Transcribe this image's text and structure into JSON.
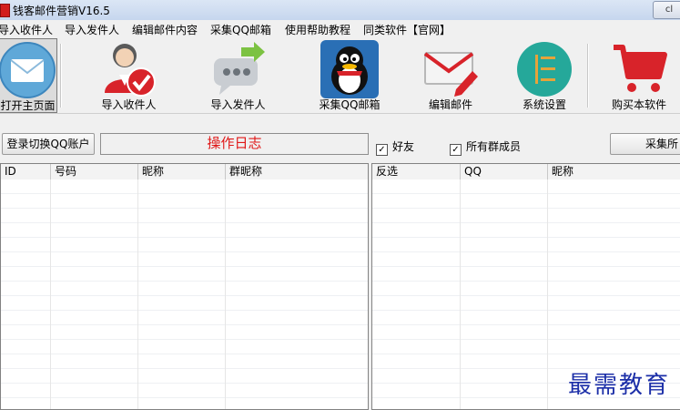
{
  "window": {
    "title": "钱客邮件营销V16.5",
    "control_label": "cl"
  },
  "menu": [
    "导入收件人",
    "导入发件人",
    "编辑邮件内容",
    "采集QQ邮箱",
    "使用帮助教程",
    "同类软件【官网】"
  ],
  "toolbar": [
    {
      "label": "打开主页面",
      "icon": "mail-envelope-icon"
    },
    {
      "label": "导入收件人",
      "icon": "user-check-icon"
    },
    {
      "label": "导入发件人",
      "icon": "chat-forward-icon"
    },
    {
      "label": "采集QQ邮箱",
      "icon": "qq-penguin-icon"
    },
    {
      "label": "编辑邮件",
      "icon": "edit-mail-icon"
    },
    {
      "label": "系统设置",
      "icon": "settings-list-icon"
    },
    {
      "label": "购买本软件",
      "icon": "shopping-cart-icon"
    }
  ],
  "controls": {
    "login_button": "登录切换QQ账户",
    "log_title": "操作日志",
    "friends_label": "好友",
    "friends_checked": true,
    "members_label": "所有群成员",
    "members_checked": true,
    "collect_button": "采集所"
  },
  "left_table": {
    "columns": [
      "ID",
      "号码",
      "昵称",
      "群昵称"
    ],
    "rows": []
  },
  "right_table": {
    "columns": [
      "反选",
      "QQ",
      "昵称"
    ],
    "rows": []
  },
  "watermark": "最需教育",
  "colors": {
    "log_text": "#e01818",
    "watermark": "#1c2fa8"
  }
}
